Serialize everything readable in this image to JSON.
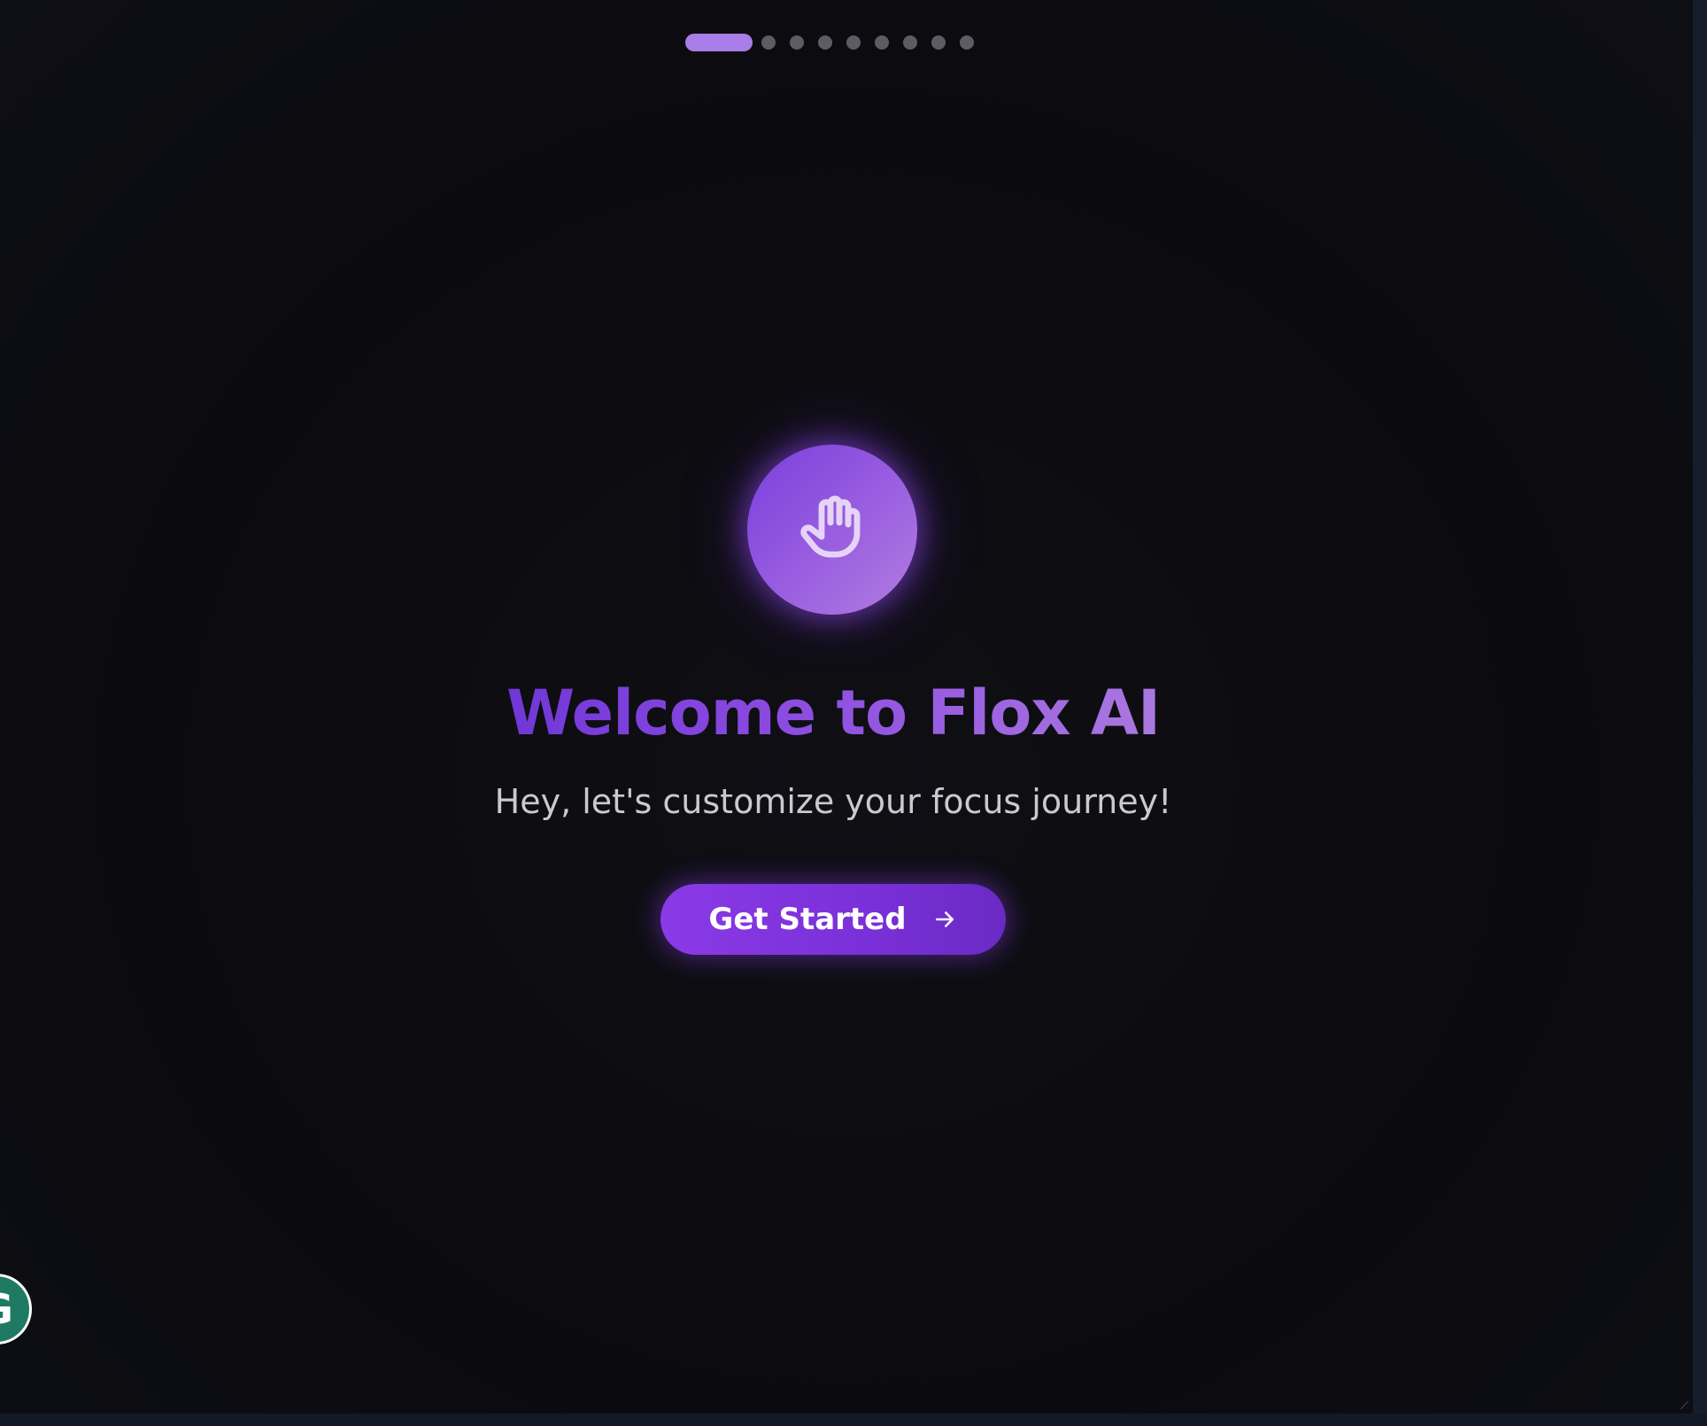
{
  "onboarding": {
    "total_steps": 9,
    "current_step": 1
  },
  "hero": {
    "icon": "hand-wave-icon",
    "title": "Welcome to Flox AI",
    "subtitle": "Hey, let's customize your focus journey!"
  },
  "cta": {
    "label": "Get Started",
    "icon": "arrow-right-icon"
  },
  "floating_badge": {
    "letter": "G"
  },
  "colors": {
    "background": "#0b0b0f",
    "accent": "#8a3ae6",
    "accent_light": "#b07ee0",
    "dot_active": "#a87de8",
    "dot_inactive": "#5c5c63",
    "subtitle": "#c9c9cf",
    "badge": "#1f7a64"
  }
}
